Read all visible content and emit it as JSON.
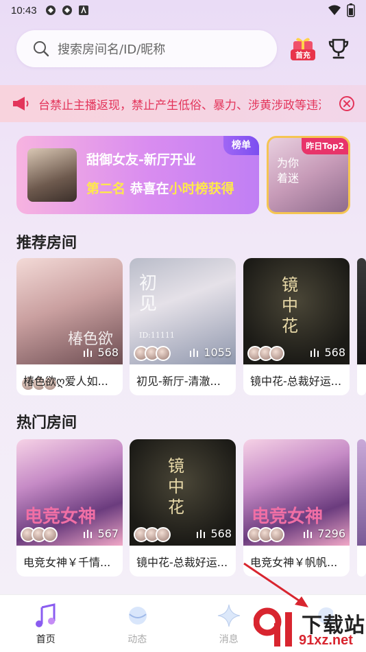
{
  "status_bar": {
    "time": "10:43"
  },
  "search": {
    "placeholder": "搜索房间名/ID/昵称"
  },
  "header": {
    "first_charge_label": "首充"
  },
  "notice": {
    "text": "台禁止主播返现，禁止产生低俗、暴力、涉黄涉政等违法"
  },
  "banner": {
    "title": "甜御女友-新厅开业",
    "subtitle_prefix": "第二名",
    "subtitle_mid": "恭喜在",
    "subtitle_suffix": "小时榜获得",
    "tag": "榜单",
    "side_tag": "昨日Top2",
    "side_calligraphy": "为你着迷"
  },
  "recommended": {
    "title": "推荐房间",
    "rooms": [
      {
        "name": "椿色欲ღ爱人如...",
        "count": "568",
        "cover_text": "椿色欲"
      },
      {
        "name": "初见-新厅-清澈...",
        "count": "1055",
        "cover_text": "初见",
        "cover_id": "ID:11111"
      },
      {
        "name": "镜中花-总裁好运...",
        "count": "568",
        "cover_text": "镜中花"
      },
      {
        "name": "...",
        "count": ""
      }
    ]
  },
  "hot": {
    "title": "热门房间",
    "rooms": [
      {
        "name": "电竞女神￥千情...",
        "count": "567",
        "cover_text": "电竞女神"
      },
      {
        "name": "镜中花-总裁好运...",
        "count": "568",
        "cover_text": "镜中花"
      },
      {
        "name": "电竞女神￥帆帆...",
        "count": "7296",
        "cover_text": "电竞女神"
      },
      {
        "name": "...",
        "count": ""
      }
    ]
  },
  "tabbar": {
    "items": [
      {
        "label": "首页",
        "icon": "music-note-icon",
        "active": true
      },
      {
        "label": "动态",
        "icon": "planet-icon",
        "active": false
      },
      {
        "label": "消息",
        "icon": "sparkle-icon",
        "active": false
      },
      {
        "label": "",
        "icon": "profile-icon",
        "active": false
      }
    ]
  },
  "watermark": {
    "big": "下载站",
    "small": "91xz.net"
  },
  "colors": {
    "accent": "#e3345a",
    "banner_yellow": "#ffe94a",
    "purple": "#a066f5"
  }
}
